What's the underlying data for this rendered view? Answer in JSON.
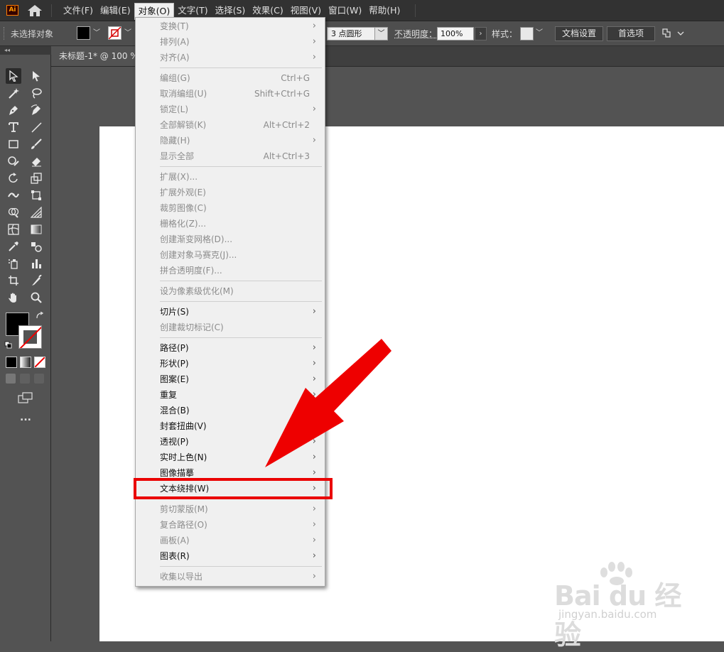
{
  "app": {
    "logo_text": "Ai",
    "menus": [
      "文件(F)",
      "编辑(E)",
      "对象(O)",
      "文字(T)",
      "选择(S)",
      "效果(C)",
      "视图(V)",
      "窗口(W)",
      "帮助(H)"
    ],
    "active_menu": "对象(O)"
  },
  "control_bar": {
    "selection_label": "未选择对象",
    "stroke_profile": "3 点圆形",
    "opacity_label": "不透明度：",
    "opacity_value": "100%",
    "style_label": "样式：",
    "doc_setup_button": "文档设置",
    "preferences_button": "首选项",
    "fill_color": "#000000",
    "stroke_color": "#ffffff"
  },
  "tab": {
    "title": "未标题-1* @ 100 %"
  },
  "toolbar": {
    "collapse_glyph": "◂◂",
    "fill_color": "#000000",
    "more_label": "..."
  },
  "object_menu": {
    "items": [
      {
        "label": "变换(T)",
        "shortcut": "",
        "submenu": true,
        "enabled": false
      },
      {
        "label": "排列(A)",
        "shortcut": "",
        "submenu": true,
        "enabled": false
      },
      {
        "label": "对齐(A)",
        "shortcut": "",
        "submenu": true,
        "enabled": false
      },
      {
        "label": "编组(G)",
        "shortcut": "Ctrl+G",
        "submenu": false,
        "enabled": false
      },
      {
        "label": "取消编组(U)",
        "shortcut": "Shift+Ctrl+G",
        "submenu": false,
        "enabled": false
      },
      {
        "label": "锁定(L)",
        "shortcut": "",
        "submenu": true,
        "enabled": false
      },
      {
        "label": "全部解锁(K)",
        "shortcut": "Alt+Ctrl+2",
        "submenu": false,
        "enabled": false
      },
      {
        "label": "隐藏(H)",
        "shortcut": "",
        "submenu": true,
        "enabled": false
      },
      {
        "label": "显示全部",
        "shortcut": "Alt+Ctrl+3",
        "submenu": false,
        "enabled": false
      },
      {
        "label": "扩展(X)...",
        "shortcut": "",
        "submenu": false,
        "enabled": false
      },
      {
        "label": "扩展外观(E)",
        "shortcut": "",
        "submenu": false,
        "enabled": false
      },
      {
        "label": "裁剪图像(C)",
        "shortcut": "",
        "submenu": false,
        "enabled": false
      },
      {
        "label": "栅格化(Z)...",
        "shortcut": "",
        "submenu": false,
        "enabled": false
      },
      {
        "label": "创建渐变网格(D)...",
        "shortcut": "",
        "submenu": false,
        "enabled": false
      },
      {
        "label": "创建对象马赛克(J)...",
        "shortcut": "",
        "submenu": false,
        "enabled": false
      },
      {
        "label": "拼合透明度(F)...",
        "shortcut": "",
        "submenu": false,
        "enabled": false
      },
      {
        "label": "设为像素级优化(M)",
        "shortcut": "",
        "submenu": false,
        "enabled": false
      },
      {
        "label": "切片(S)",
        "shortcut": "",
        "submenu": true,
        "enabled": true
      },
      {
        "label": "创建裁切标记(C)",
        "shortcut": "",
        "submenu": false,
        "enabled": false
      },
      {
        "label": "路径(P)",
        "shortcut": "",
        "submenu": true,
        "enabled": true
      },
      {
        "label": "形状(P)",
        "shortcut": "",
        "submenu": true,
        "enabled": true
      },
      {
        "label": "图案(E)",
        "shortcut": "",
        "submenu": true,
        "enabled": true
      },
      {
        "label": "重复",
        "shortcut": "",
        "submenu": true,
        "enabled": true
      },
      {
        "label": "混合(B)",
        "shortcut": "",
        "submenu": true,
        "enabled": true
      },
      {
        "label": "封套扭曲(V)",
        "shortcut": "",
        "submenu": true,
        "enabled": true
      },
      {
        "label": "透视(P)",
        "shortcut": "",
        "submenu": true,
        "enabled": true
      },
      {
        "label": "实时上色(N)",
        "shortcut": "",
        "submenu": true,
        "enabled": true
      },
      {
        "label": "图像描摹",
        "shortcut": "",
        "submenu": true,
        "enabled": true
      },
      {
        "label": "文本绕排(W)",
        "shortcut": "",
        "submenu": true,
        "enabled": true
      },
      {
        "label": "剪切蒙版(M)",
        "shortcut": "",
        "submenu": true,
        "enabled": false
      },
      {
        "label": "复合路径(O)",
        "shortcut": "",
        "submenu": true,
        "enabled": false
      },
      {
        "label": "画板(A)",
        "shortcut": "",
        "submenu": true,
        "enabled": false
      },
      {
        "label": "图表(R)",
        "shortcut": "",
        "submenu": true,
        "enabled": true
      },
      {
        "label": "收集以导出",
        "shortcut": "",
        "submenu": true,
        "enabled": false
      }
    ],
    "highlighted_item": "文本绕排(W)",
    "annotation_color": "#ea0000"
  },
  "watermark": {
    "main": "Bai du 经验",
    "sub": "jingyan.baidu.com"
  }
}
